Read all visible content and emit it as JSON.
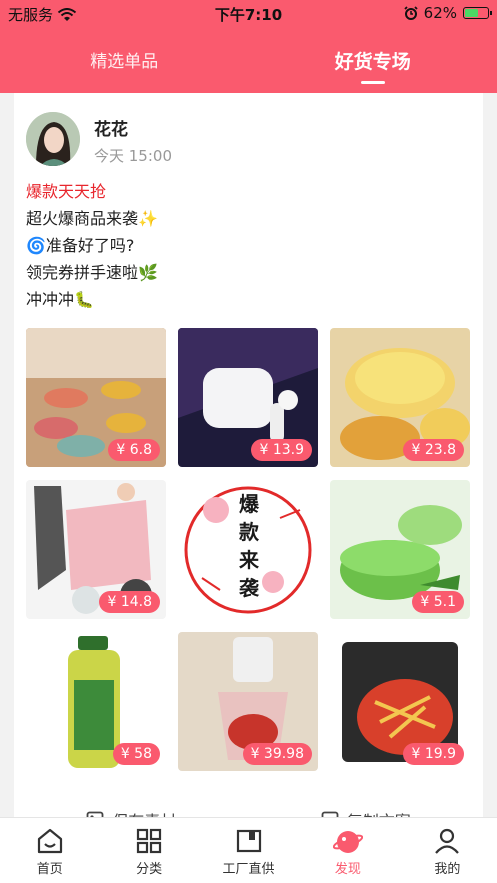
{
  "status": {
    "carrier": "无服务",
    "time": "下午7:10",
    "battery": "62%",
    "battery_level": 0.62
  },
  "tabs": [
    {
      "label": "精选单品"
    },
    {
      "label": "好货专场"
    }
  ],
  "post": {
    "username": "花花",
    "time": "今天 15:00",
    "lines": [
      "爆款天天抢",
      "超火爆商品来袭✨",
      "🌀准备好了吗?",
      "领完券拼手速啦🌿",
      "冲冲冲🐛"
    ]
  },
  "products": [
    {
      "price": "¥ 6.8"
    },
    {
      "price": "¥ 13.9"
    },
    {
      "price": "¥ 23.8"
    },
    {
      "price": "¥ 14.8"
    },
    {
      "price": ""
    },
    {
      "price": "¥ 5.1"
    },
    {
      "price": "¥ 58"
    },
    {
      "price": "¥ 39.98"
    },
    {
      "price": "¥ 19.9"
    }
  ],
  "poster_text": [
    "爆",
    "款",
    "来",
    "袭"
  ],
  "actions": {
    "save": "保存素材",
    "copy": "复制文案"
  },
  "nav": [
    {
      "label": "首页",
      "icon": "home-icon"
    },
    {
      "label": "分类",
      "icon": "category-icon"
    },
    {
      "label": "工厂直供",
      "icon": "factory-icon"
    },
    {
      "label": "发现",
      "icon": "discover-icon"
    },
    {
      "label": "我的",
      "icon": "profile-icon"
    }
  ],
  "colors": {
    "brand": "#fa5a6e",
    "highlight": "#e8262d"
  }
}
